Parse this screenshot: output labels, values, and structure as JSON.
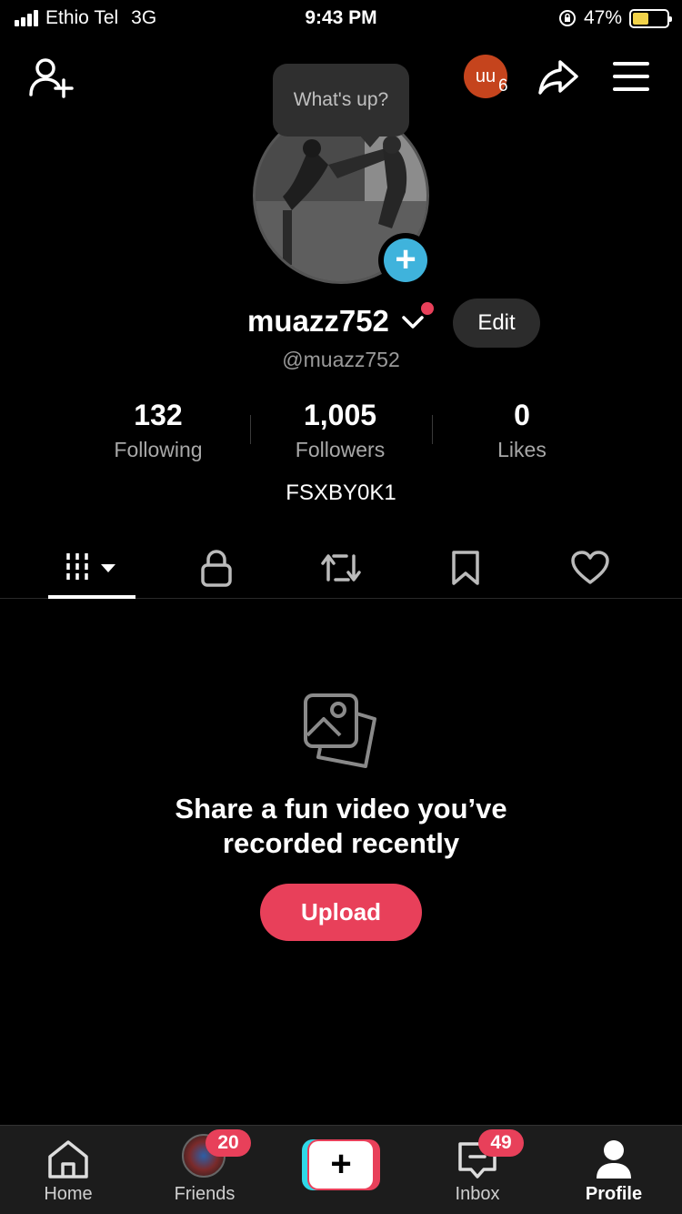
{
  "status_bar": {
    "carrier": "Ethio Tel",
    "network": "3G",
    "time": "9:43 PM",
    "battery_percent": "47%",
    "battery_level": 0.47,
    "battery_color": "#f2d34a"
  },
  "header": {
    "add_friend_icon": "person-plus-icon",
    "mini_avatar_initials": "uu",
    "mini_avatar_count": "6",
    "mini_avatar_color": "#c5441d",
    "share_icon": "share-arrow-icon",
    "menu_icon": "hamburger-menu-icon"
  },
  "profile": {
    "tooltip": "What's up?",
    "username": "muazz752",
    "handle": "@muazz752",
    "edit_label": "Edit",
    "bio": "FSXBY0K1",
    "add_photo_symbol": "+"
  },
  "stats": [
    {
      "value": "132",
      "label": "Following"
    },
    {
      "value": "1,005",
      "label": "Followers"
    },
    {
      "value": "0",
      "label": "Likes"
    }
  ],
  "tabs": [
    {
      "icon": "videos-grid-icon",
      "active": true
    },
    {
      "icon": "lock-icon",
      "active": false
    },
    {
      "icon": "repost-icon",
      "active": false
    },
    {
      "icon": "bookmark-icon",
      "active": false
    },
    {
      "icon": "heart-icon",
      "active": false
    }
  ],
  "empty_state": {
    "line1": "Share a fun video you’ve",
    "line2": "recorded recently",
    "upload_label": "Upload"
  },
  "bottom_nav": {
    "home": {
      "label": "Home"
    },
    "friends": {
      "label": "Friends",
      "badge": "20"
    },
    "create": {
      "symbol": "+"
    },
    "inbox": {
      "label": "Inbox",
      "badge": "49"
    },
    "profile": {
      "label": "Profile"
    }
  },
  "colors": {
    "accent": "#e8405a",
    "cyan": "#2fd8e8",
    "add_photo": "#3fb3dc"
  }
}
